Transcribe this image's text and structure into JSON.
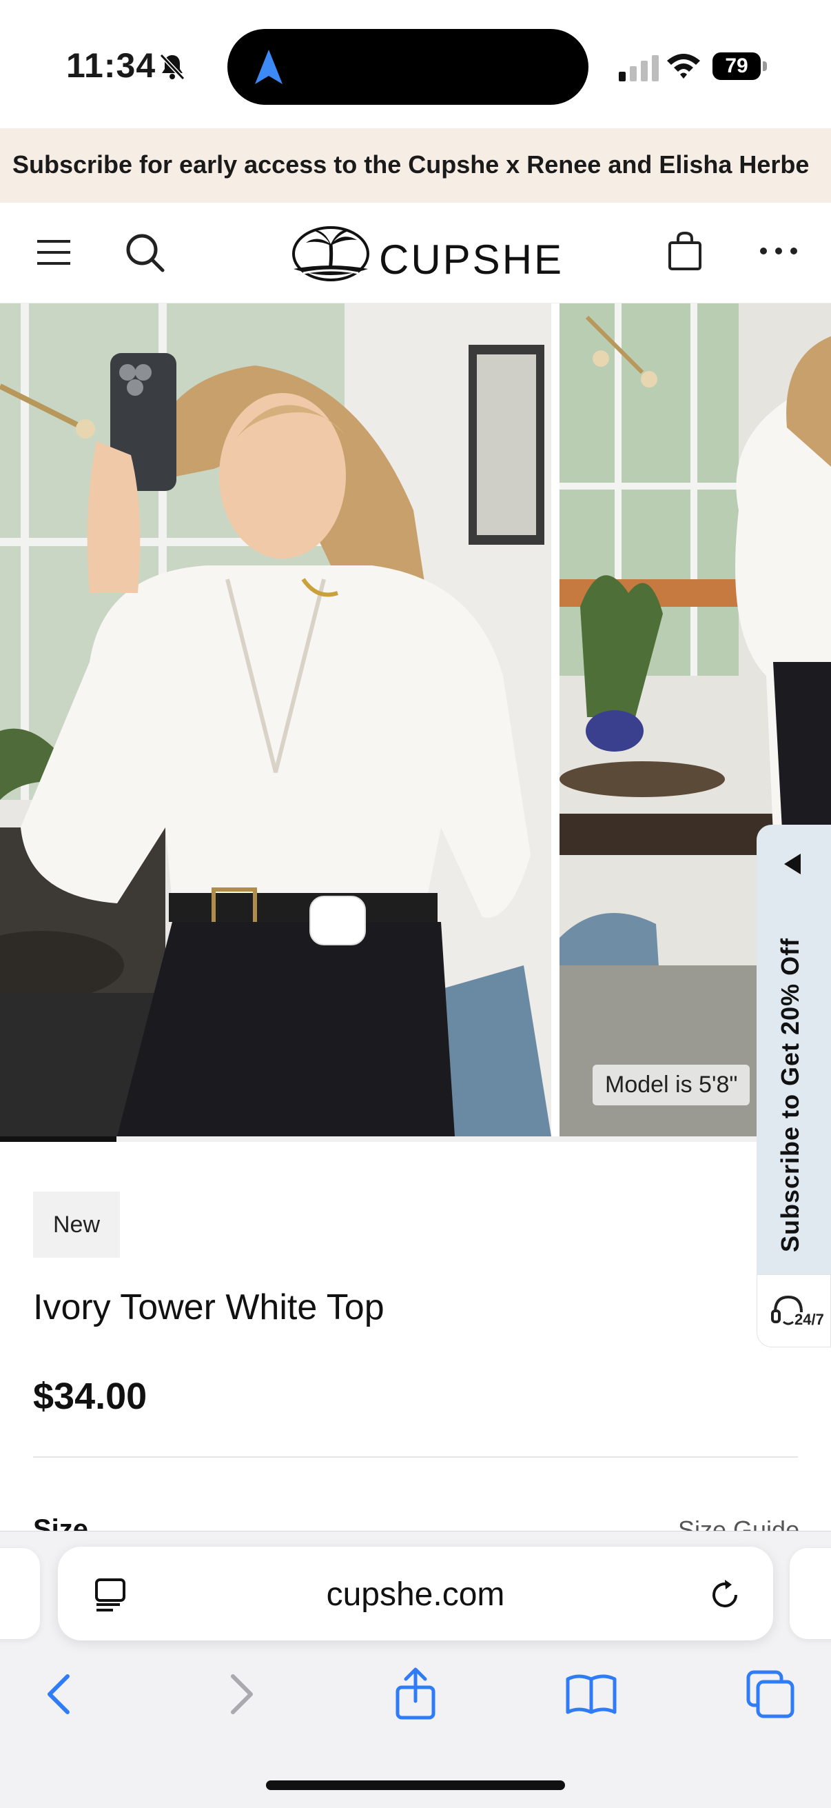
{
  "status_bar": {
    "time": "11:34",
    "battery": "79"
  },
  "announcement": {
    "text": "Subscribe for early access to the Cupshe x Renee and Elisha Herbe"
  },
  "header": {
    "brand": "CUPSHE"
  },
  "gallery": {
    "model_note": "Model is 5'8\"",
    "progress_fraction": 0.14
  },
  "side_tab": {
    "subscribe_text": "Subscribe to Get 20% Off",
    "chat_label": "24/7"
  },
  "product": {
    "badge": "New",
    "title": "Ivory Tower White Top",
    "price": "$34.00",
    "size_label": "Size",
    "size_guide": "Size Guide"
  },
  "browser": {
    "url": "cupshe.com"
  },
  "colors": {
    "announcement_bg": "#f6ede4",
    "side_tab_bg": "#dfe9ef",
    "ios_blue": "#2f7cf6"
  }
}
